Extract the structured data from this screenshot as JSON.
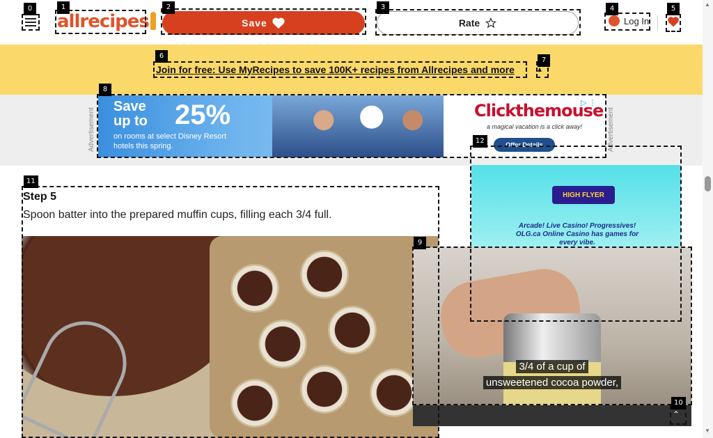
{
  "header": {
    "logo_text": "allrecipes",
    "save_label": "Save",
    "rate_label": "Rate",
    "login_label": "Log In"
  },
  "banner": {
    "link_text": "Join for free: Use MyRecipes to save 100K+ recipes from Allrecipes and more"
  },
  "ad_top": {
    "side_label": "Advertisement",
    "promo_line1": "Save",
    "promo_line2": "up to",
    "promo_pct": "25%",
    "promo_sub": "on rooms at select Disney Resort hotels this spring.",
    "brand": "Clickthemouse",
    "tagline": "a magical vacation is a click away!",
    "cta": "Offer Details"
  },
  "content": {
    "step_title": "Step 5",
    "step_text": "Spoon batter into the prepared muffin cups, filling each 3/4 full."
  },
  "side_ad": {
    "title": "HIGH FLYER",
    "text": "Arcade! Live Casino! Progressives! OLG.ca Online Casino has games for every vibe."
  },
  "video": {
    "caption_line1": "3/4 of a cup of",
    "caption_line2": "unsweetened cocoa powder,"
  },
  "annotations": [
    "0",
    "1",
    "2",
    "3",
    "4",
    "5",
    "6",
    "7",
    "8",
    "9",
    "10",
    "11",
    "12"
  ],
  "colors": {
    "brand": "#e0542b",
    "save_button": "#d7401f",
    "banner": "#fbd86a"
  }
}
